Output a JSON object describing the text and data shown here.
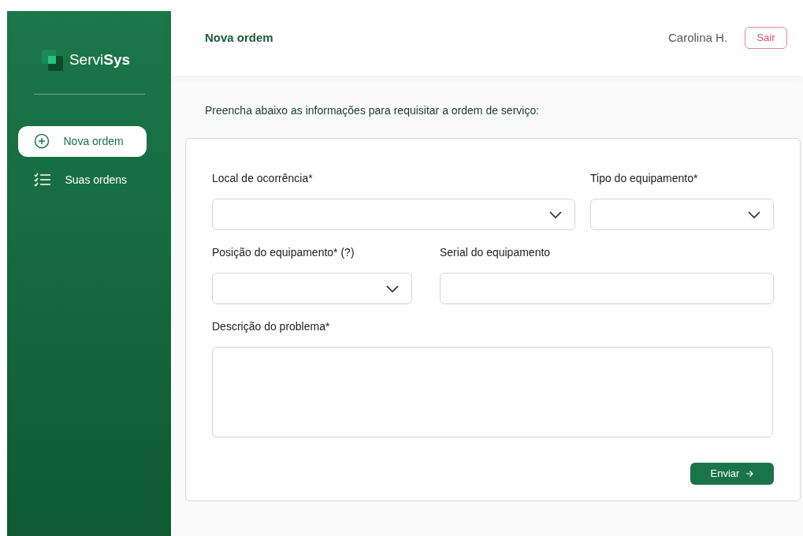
{
  "sidebar": {
    "brand": {
      "light": "Servi",
      "bold": "Sys"
    },
    "items": [
      {
        "label": "Nova ordem",
        "selected": true
      },
      {
        "label": "Suas ordens",
        "selected": false
      }
    ]
  },
  "header": {
    "title": "Nova ordem",
    "user": "Carolina H.",
    "logout": "Sair"
  },
  "intro": "Preencha abaixo as informações para requisitar a ordem de serviço:",
  "form": {
    "rows": [
      [
        {
          "label": "Local de ocorrência*",
          "kind": "select"
        },
        {
          "label": "Tipo do equipamento*",
          "kind": "select"
        }
      ],
      [
        {
          "label": "Posição do equipamento* (?)",
          "kind": "select"
        },
        {
          "label": "Serial do equipamento",
          "kind": "text"
        }
      ],
      [
        {
          "label": "Descrição do problema*",
          "kind": "textarea"
        }
      ]
    ],
    "submit": "Enviar"
  }
}
